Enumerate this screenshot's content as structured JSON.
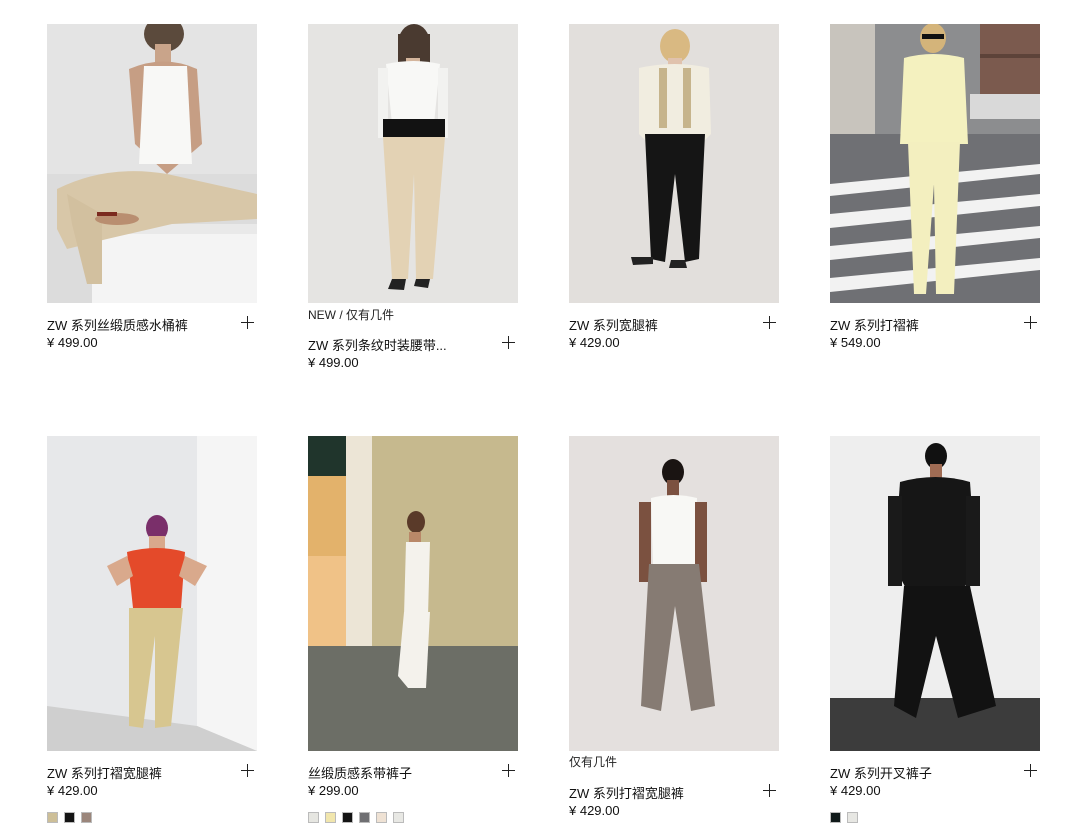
{
  "products": [
    {
      "tag": "",
      "title": "ZW 系列丝缎质感水桶裤",
      "price": "¥ 499.00",
      "swatches": []
    },
    {
      "tag": "NEW / 仅有几件",
      "title": "ZW 系列条纹时装腰带...",
      "price": "¥ 499.00",
      "swatches": []
    },
    {
      "tag": "",
      "title": "ZW 系列宽腿裤",
      "price": "¥ 429.00",
      "swatches": []
    },
    {
      "tag": "",
      "title": "ZW 系列打褶裤",
      "price": "¥ 549.00",
      "swatches": []
    },
    {
      "tag": "",
      "title": "ZW 系列打褶宽腿裤",
      "price": "¥ 429.00",
      "swatches": [
        "#cdbf98",
        "#141414",
        "#9b867b"
      ]
    },
    {
      "tag": "",
      "title": "丝缎质感系带裤子",
      "price": "¥ 299.00",
      "swatches": [
        "#e6e6e1",
        "#f1e6ad",
        "#141414",
        "#6f6f72",
        "#efe2d4",
        "#e8e8e4"
      ]
    },
    {
      "tag": "仅有几件",
      "title": "ZW 系列打褶宽腿裤",
      "price": "¥ 429.00",
      "swatches": []
    },
    {
      "tag": "",
      "title": "ZW 系列开叉裤子",
      "price": "¥ 429.00",
      "swatches": [
        "#101a1a",
        "#e7e7e3"
      ]
    }
  ],
  "icons": {
    "add": "plus-icon"
  }
}
